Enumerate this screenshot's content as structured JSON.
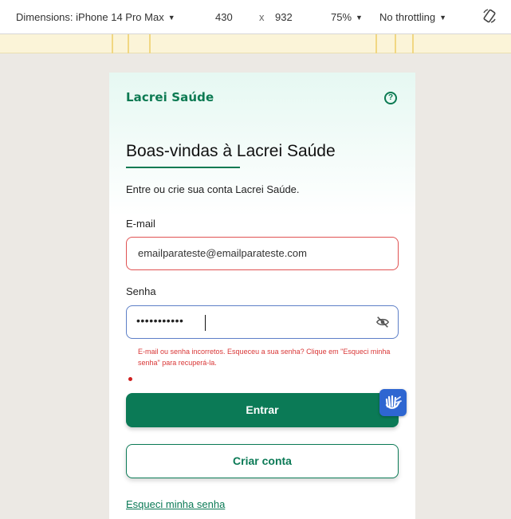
{
  "devtools": {
    "dimensions_label": "Dimensions: iPhone 14 Pro Max",
    "width": "430",
    "times": "x",
    "height": "932",
    "zoom": "75%",
    "throttling": "No throttling"
  },
  "app": {
    "logo": "Lacrei Saúde",
    "help_icon": "?"
  },
  "login": {
    "title": "Boas-vindas à Lacrei Saúde",
    "subtitle": "Entre ou crie sua conta Lacrei Saúde.",
    "email_label": "E-mail",
    "email_value": "emailparateste@emailparateste.com",
    "password_label": "Senha",
    "password_value": "•••••••••••",
    "error_message": "E-mail ou senha incorretos. Esqueceu a sua senha? Clique em \"Esqueci minha senha\" para recuperá-la.",
    "submit_label": "Entrar",
    "create_account_label": "Criar conta",
    "forgot_password_label": "Esqueci minha senha"
  },
  "colors": {
    "brand_green": "#0b7a56",
    "error_red": "#d93737",
    "focus_blue": "#5d7fc7",
    "accessibility_blue": "#2e66d1"
  }
}
